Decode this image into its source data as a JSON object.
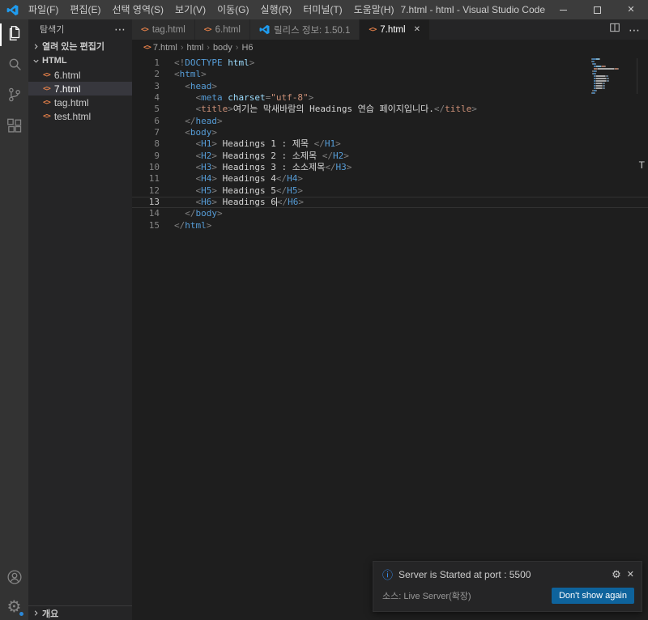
{
  "palette": {
    "tag": "#569cd6",
    "tag_alt": "#ce9178",
    "attr": "#9cdcfe",
    "string": "#ce9178",
    "text": "#d4d4d4",
    "punct": "#808080",
    "accent": "#007acc",
    "html_icon": "#e8824a",
    "button": "#0e639c",
    "info": "#3794ff"
  },
  "icons": {
    "close": "✕",
    "gear": "⚙",
    "more": "⋯",
    "html_file": "<>",
    "info": "ⓘ",
    "chevron_sep": "›"
  },
  "window": {
    "title": "7.html - html - Visual Studio Code",
    "menus": [
      "파일(F)",
      "편집(E)",
      "선택 영역(S)",
      "보기(V)",
      "이동(G)",
      "실행(R)",
      "터미널(T)",
      "도움말(H)"
    ]
  },
  "sidebar": {
    "title": "탐색기",
    "open_editors_label": "열려 있는 편집기",
    "folder_label": "HTML",
    "outline_label": "개요",
    "files": [
      {
        "label": "6.html",
        "selected": false
      },
      {
        "label": "7.html",
        "selected": true
      },
      {
        "label": "tag.html",
        "selected": false
      },
      {
        "label": "test.html",
        "selected": false
      }
    ]
  },
  "tabs": [
    {
      "id": "tag-html",
      "label": "tag.html",
      "icon": "html",
      "active": false
    },
    {
      "id": "6-html",
      "label": "6.html",
      "icon": "html",
      "active": false
    },
    {
      "id": "release-notes",
      "label": "릴리스 정보: 1.50.1",
      "icon": "vscode",
      "active": false
    },
    {
      "id": "7-html",
      "label": "7.html",
      "icon": "html",
      "active": true
    }
  ],
  "breadcrumb": [
    "7.html",
    "html",
    "body",
    "H6"
  ],
  "editor": {
    "cursor_line": 13,
    "stray_char": "T",
    "lines": [
      {
        "n": 1,
        "tokens": [
          [
            "punct",
            "<!"
          ],
          [
            "tag",
            "DOCTYPE"
          ],
          [
            "attr",
            " html"
          ],
          [
            "punct",
            ">"
          ]
        ]
      },
      {
        "n": 2,
        "tokens": [
          [
            "punct",
            "<"
          ],
          [
            "tag",
            "html"
          ],
          [
            "punct",
            ">"
          ]
        ]
      },
      {
        "n": 3,
        "tokens": [
          [
            "punct",
            "  <"
          ],
          [
            "tag",
            "head"
          ],
          [
            "punct",
            ">"
          ]
        ]
      },
      {
        "n": 4,
        "tokens": [
          [
            "punct",
            "    <"
          ],
          [
            "tag",
            "meta"
          ],
          [
            "text",
            " "
          ],
          [
            "attr",
            "charset"
          ],
          [
            "punct",
            "="
          ],
          [
            "string",
            "\"utf-8\""
          ],
          [
            "punct",
            ">"
          ]
        ]
      },
      {
        "n": 5,
        "tokens": [
          [
            "punct",
            "    <"
          ],
          [
            "tag_alt",
            "title"
          ],
          [
            "punct",
            ">"
          ],
          [
            "text",
            "여기는 막새바람의 Headings 연습 페이지입니다."
          ],
          [
            "punct",
            "</"
          ],
          [
            "tag_alt",
            "title"
          ],
          [
            "punct",
            ">"
          ]
        ]
      },
      {
        "n": 6,
        "tokens": [
          [
            "punct",
            "  </"
          ],
          [
            "tag",
            "head"
          ],
          [
            "punct",
            ">"
          ]
        ]
      },
      {
        "n": 7,
        "tokens": [
          [
            "punct",
            "  <"
          ],
          [
            "tag",
            "body"
          ],
          [
            "punct",
            ">"
          ]
        ]
      },
      {
        "n": 8,
        "tokens": [
          [
            "punct",
            "    <"
          ],
          [
            "tag",
            "H1"
          ],
          [
            "punct",
            ">"
          ],
          [
            "text",
            " Headings 1 : 제목 "
          ],
          [
            "punct",
            "</"
          ],
          [
            "tag",
            "H1"
          ],
          [
            "punct",
            ">"
          ]
        ]
      },
      {
        "n": 9,
        "tokens": [
          [
            "punct",
            "    <"
          ],
          [
            "tag",
            "H2"
          ],
          [
            "punct",
            ">"
          ],
          [
            "text",
            " Headings 2 : 소제목 "
          ],
          [
            "punct",
            "</"
          ],
          [
            "tag",
            "H2"
          ],
          [
            "punct",
            ">"
          ]
        ]
      },
      {
        "n": 10,
        "tokens": [
          [
            "punct",
            "    <"
          ],
          [
            "tag",
            "H3"
          ],
          [
            "punct",
            ">"
          ],
          [
            "text",
            " Headings 3 : 소소제목"
          ],
          [
            "punct",
            "</"
          ],
          [
            "tag",
            "H3"
          ],
          [
            "punct",
            ">"
          ]
        ]
      },
      {
        "n": 11,
        "tokens": [
          [
            "punct",
            "    <"
          ],
          [
            "tag",
            "H4"
          ],
          [
            "punct",
            ">"
          ],
          [
            "text",
            " Headings 4"
          ],
          [
            "punct",
            "</"
          ],
          [
            "tag",
            "H4"
          ],
          [
            "punct",
            ">"
          ]
        ]
      },
      {
        "n": 12,
        "tokens": [
          [
            "punct",
            "    <"
          ],
          [
            "tag",
            "H5"
          ],
          [
            "punct",
            ">"
          ],
          [
            "text",
            " Headings 5"
          ],
          [
            "punct",
            "</"
          ],
          [
            "tag",
            "H5"
          ],
          [
            "punct",
            ">"
          ]
        ]
      },
      {
        "n": 13,
        "tokens": [
          [
            "punct",
            "    <"
          ],
          [
            "tag",
            "H6"
          ],
          [
            "punct",
            ">"
          ],
          [
            "text",
            " Headings 6"
          ],
          [
            "cursor",
            ""
          ],
          [
            "punct",
            "</"
          ],
          [
            "tag",
            "H6"
          ],
          [
            "punct",
            ">"
          ]
        ]
      },
      {
        "n": 14,
        "tokens": [
          [
            "punct",
            "  </"
          ],
          [
            "tag",
            "body"
          ],
          [
            "punct",
            ">"
          ]
        ]
      },
      {
        "n": 15,
        "tokens": [
          [
            "punct",
            "</"
          ],
          [
            "tag",
            "html"
          ],
          [
            "punct",
            ">"
          ]
        ]
      }
    ]
  },
  "notification": {
    "message": "Server is Started at port : 5500",
    "source": "소스: Live Server(확장)",
    "button_label": "Don't show again"
  }
}
